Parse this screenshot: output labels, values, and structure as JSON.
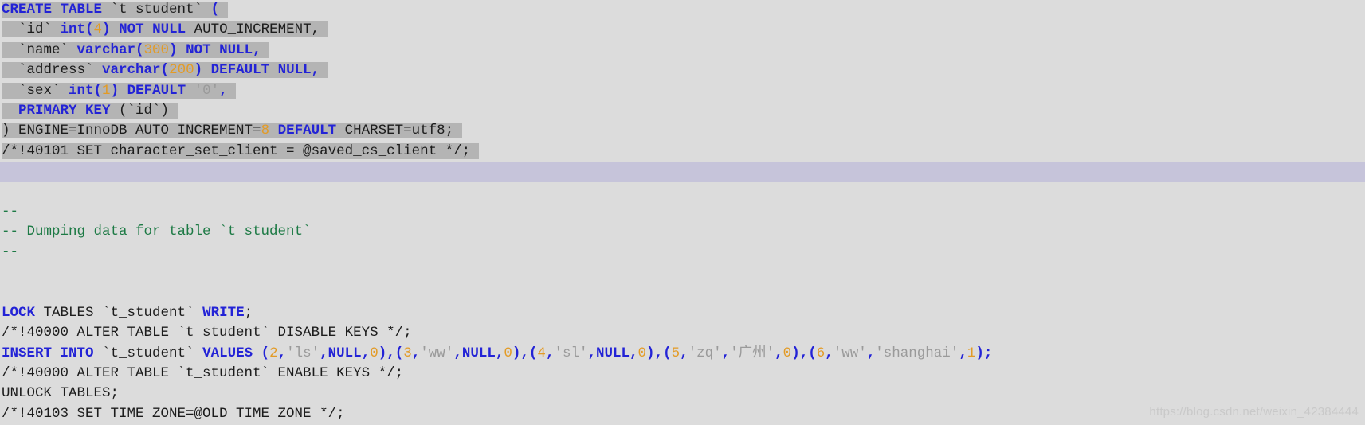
{
  "editor": {
    "kind": "sql-dump-text-view",
    "background_color": "#dcdcdc",
    "selection_color": "#b4b4b4",
    "highlight_band_color": "#c6c4da",
    "colors": {
      "keyword": "#2323d6",
      "number": "#e39b26",
      "string": "#9a9a9a",
      "comment": "#1d7a45",
      "plain": "#1c1c1c"
    },
    "lines": [
      {
        "id": "line-create-table",
        "selected": true,
        "tokens": [
          {
            "t": "CREATE TABLE",
            "c": "kw"
          },
          {
            "t": " `t_student` ",
            "c": "plain"
          },
          {
            "t": "(",
            "c": "punct"
          }
        ]
      },
      {
        "id": "line-col-id",
        "selected": true,
        "tokens": [
          {
            "t": "  `id` ",
            "c": "plain"
          },
          {
            "t": "int",
            "c": "kw"
          },
          {
            "t": "(",
            "c": "punct"
          },
          {
            "t": "4",
            "c": "num"
          },
          {
            "t": ")",
            "c": "punct"
          },
          {
            "t": " ",
            "c": "plain"
          },
          {
            "t": "NOT NULL",
            "c": "kw"
          },
          {
            "t": " AUTO_INCREMENT,",
            "c": "plain"
          }
        ]
      },
      {
        "id": "line-col-name",
        "selected": true,
        "tokens": [
          {
            "t": "  `name` ",
            "c": "plain"
          },
          {
            "t": "varchar",
            "c": "kw"
          },
          {
            "t": "(",
            "c": "punct"
          },
          {
            "t": "300",
            "c": "num"
          },
          {
            "t": ")",
            "c": "punct"
          },
          {
            "t": " ",
            "c": "plain"
          },
          {
            "t": "NOT NULL",
            "c": "kw"
          },
          {
            "t": ",",
            "c": "punct"
          }
        ]
      },
      {
        "id": "line-col-address",
        "selected": true,
        "tokens": [
          {
            "t": "  `address` ",
            "c": "plain"
          },
          {
            "t": "varchar",
            "c": "kw"
          },
          {
            "t": "(",
            "c": "punct"
          },
          {
            "t": "200",
            "c": "num"
          },
          {
            "t": ")",
            "c": "punct"
          },
          {
            "t": " ",
            "c": "plain"
          },
          {
            "t": "DEFAULT NULL",
            "c": "kw"
          },
          {
            "t": ",",
            "c": "punct"
          }
        ]
      },
      {
        "id": "line-col-sex",
        "selected": true,
        "tokens": [
          {
            "t": "  `sex` ",
            "c": "plain"
          },
          {
            "t": "int",
            "c": "kw"
          },
          {
            "t": "(",
            "c": "punct"
          },
          {
            "t": "1",
            "c": "num"
          },
          {
            "t": ")",
            "c": "punct"
          },
          {
            "t": " ",
            "c": "plain"
          },
          {
            "t": "DEFAULT",
            "c": "kw"
          },
          {
            "t": " '0'",
            "c": "str"
          },
          {
            "t": ",",
            "c": "punct"
          }
        ]
      },
      {
        "id": "line-primary-key",
        "selected": true,
        "tokens": [
          {
            "t": "  ",
            "c": "plain"
          },
          {
            "t": "PRIMARY KEY",
            "c": "kw"
          },
          {
            "t": " (`id`)",
            "c": "plain"
          }
        ]
      },
      {
        "id": "line-engine",
        "selected": true,
        "tokens": [
          {
            "t": ") ENGINE=InnoDB AUTO_INCREMENT=",
            "c": "plain"
          },
          {
            "t": "8",
            "c": "num"
          },
          {
            "t": " ",
            "c": "plain"
          },
          {
            "t": "DEFAULT",
            "c": "kw"
          },
          {
            "t": " CHARSET=utf8;",
            "c": "plain"
          }
        ]
      },
      {
        "id": "line-set-charset-client",
        "selected": true,
        "tokens": [
          {
            "t": "/*!40101 SET character_set_client = @saved_cs_client */;",
            "c": "plain"
          }
        ]
      },
      {
        "id": "line-blank-highlight",
        "band": true,
        "tokens": [
          {
            "t": "",
            "c": "plain"
          }
        ]
      },
      {
        "id": "line-blank-1",
        "tokens": [
          {
            "t": "",
            "c": "plain"
          }
        ]
      },
      {
        "id": "line-comment-dash-1",
        "tokens": [
          {
            "t": "--",
            "c": "cmt"
          }
        ]
      },
      {
        "id": "line-comment-dumping",
        "tokens": [
          {
            "t": "-- Dumping data for table `t_student`",
            "c": "cmt"
          }
        ]
      },
      {
        "id": "line-comment-dash-2",
        "tokens": [
          {
            "t": "--",
            "c": "cmt"
          }
        ]
      },
      {
        "id": "line-blank-2",
        "tokens": [
          {
            "t": "",
            "c": "plain"
          }
        ]
      },
      {
        "id": "line-blank-3",
        "tokens": [
          {
            "t": "",
            "c": "plain"
          }
        ]
      },
      {
        "id": "line-lock-tables",
        "tokens": [
          {
            "t": "LOCK",
            "c": "kw"
          },
          {
            "t": " TABLES `t_student` ",
            "c": "plain"
          },
          {
            "t": "WRITE",
            "c": "kw"
          },
          {
            "t": ";",
            "c": "plain"
          }
        ]
      },
      {
        "id": "line-alter-disable-keys",
        "tokens": [
          {
            "t": "/*!40000 ALTER TABLE `t_student` DISABLE KEYS */;",
            "c": "plain"
          }
        ]
      },
      {
        "id": "line-insert-into",
        "tokens": [
          {
            "t": "INSERT INTO",
            "c": "kw"
          },
          {
            "t": " `t_student` ",
            "c": "plain"
          },
          {
            "t": "VALUES",
            "c": "kw"
          },
          {
            "t": " ",
            "c": "plain"
          },
          {
            "t": "(",
            "c": "punct"
          },
          {
            "t": "2",
            "c": "num"
          },
          {
            "t": ",",
            "c": "punct"
          },
          {
            "t": "'ls'",
            "c": "str"
          },
          {
            "t": ",",
            "c": "punct"
          },
          {
            "t": "NULL",
            "c": "kw"
          },
          {
            "t": ",",
            "c": "punct"
          },
          {
            "t": "0",
            "c": "num"
          },
          {
            "t": ")",
            "c": "punct"
          },
          {
            "t": ",",
            "c": "punct"
          },
          {
            "t": "(",
            "c": "punct"
          },
          {
            "t": "3",
            "c": "num"
          },
          {
            "t": ",",
            "c": "punct"
          },
          {
            "t": "'ww'",
            "c": "str"
          },
          {
            "t": ",",
            "c": "punct"
          },
          {
            "t": "NULL",
            "c": "kw"
          },
          {
            "t": ",",
            "c": "punct"
          },
          {
            "t": "0",
            "c": "num"
          },
          {
            "t": ")",
            "c": "punct"
          },
          {
            "t": ",",
            "c": "punct"
          },
          {
            "t": "(",
            "c": "punct"
          },
          {
            "t": "4",
            "c": "num"
          },
          {
            "t": ",",
            "c": "punct"
          },
          {
            "t": "'sl'",
            "c": "str"
          },
          {
            "t": ",",
            "c": "punct"
          },
          {
            "t": "NULL",
            "c": "kw"
          },
          {
            "t": ",",
            "c": "punct"
          },
          {
            "t": "0",
            "c": "num"
          },
          {
            "t": ")",
            "c": "punct"
          },
          {
            "t": ",",
            "c": "punct"
          },
          {
            "t": "(",
            "c": "punct"
          },
          {
            "t": "5",
            "c": "num"
          },
          {
            "t": ",",
            "c": "punct"
          },
          {
            "t": "'zq'",
            "c": "str"
          },
          {
            "t": ",",
            "c": "punct"
          },
          {
            "t": "'广州'",
            "c": "str"
          },
          {
            "t": ",",
            "c": "punct"
          },
          {
            "t": "0",
            "c": "num"
          },
          {
            "t": ")",
            "c": "punct"
          },
          {
            "t": ",",
            "c": "punct"
          },
          {
            "t": "(",
            "c": "punct"
          },
          {
            "t": "6",
            "c": "num"
          },
          {
            "t": ",",
            "c": "punct"
          },
          {
            "t": "'ww'",
            "c": "str"
          },
          {
            "t": ",",
            "c": "punct"
          },
          {
            "t": "'shanghai'",
            "c": "str"
          },
          {
            "t": ",",
            "c": "punct"
          },
          {
            "t": "1",
            "c": "num"
          },
          {
            "t": ")",
            "c": "punct"
          },
          {
            "t": ";",
            "c": "punct"
          }
        ]
      },
      {
        "id": "line-alter-enable-keys",
        "tokens": [
          {
            "t": "/*!40000 ALTER TABLE `t_student` ENABLE KEYS */;",
            "c": "plain"
          }
        ]
      },
      {
        "id": "line-unlock-tables",
        "tokens": [
          {
            "t": "UNLOCK TABLES;",
            "c": "plain"
          }
        ]
      },
      {
        "id": "line-set-time-zone",
        "caret_after": 13,
        "tokens": [
          {
            "t": "/*!40103 SET TIME ZONE=@OLD TIME ZONE */;",
            "c": "plain"
          }
        ]
      }
    ]
  },
  "watermark": {
    "text": "https://blog.csdn.net/weixin_42384444"
  }
}
